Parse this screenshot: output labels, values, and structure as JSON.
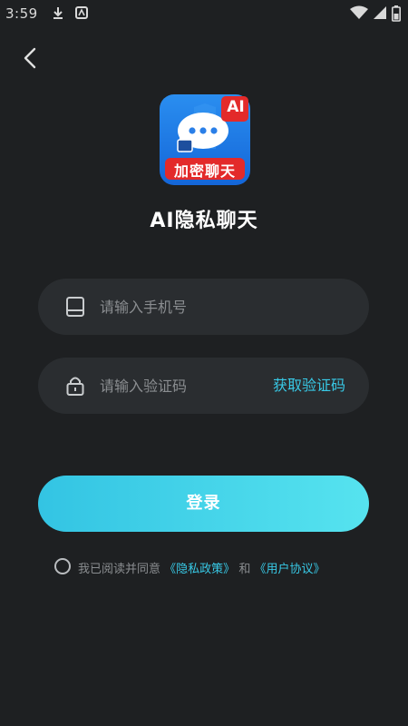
{
  "status_bar": {
    "time": "3:59"
  },
  "app": {
    "name": "AI隐私聊天",
    "logo_badge": "AI",
    "logo_banner": "加密聊天"
  },
  "phone": {
    "placeholder": "请输入手机号",
    "value": ""
  },
  "code": {
    "placeholder": "请输入验证码",
    "value": "",
    "get_code_label": "获取验证码"
  },
  "login": {
    "label": "登录"
  },
  "agreement": {
    "prefix": "我已阅读并同意",
    "privacy_link": "《隐私政策》",
    "conjunction": "和",
    "terms_link": "《用户协议》",
    "checked": false
  },
  "colors": {
    "background": "#1e2022",
    "field_background": "#2a2d30",
    "accent": "#38c9e6",
    "placeholder": "#8a8d90"
  }
}
